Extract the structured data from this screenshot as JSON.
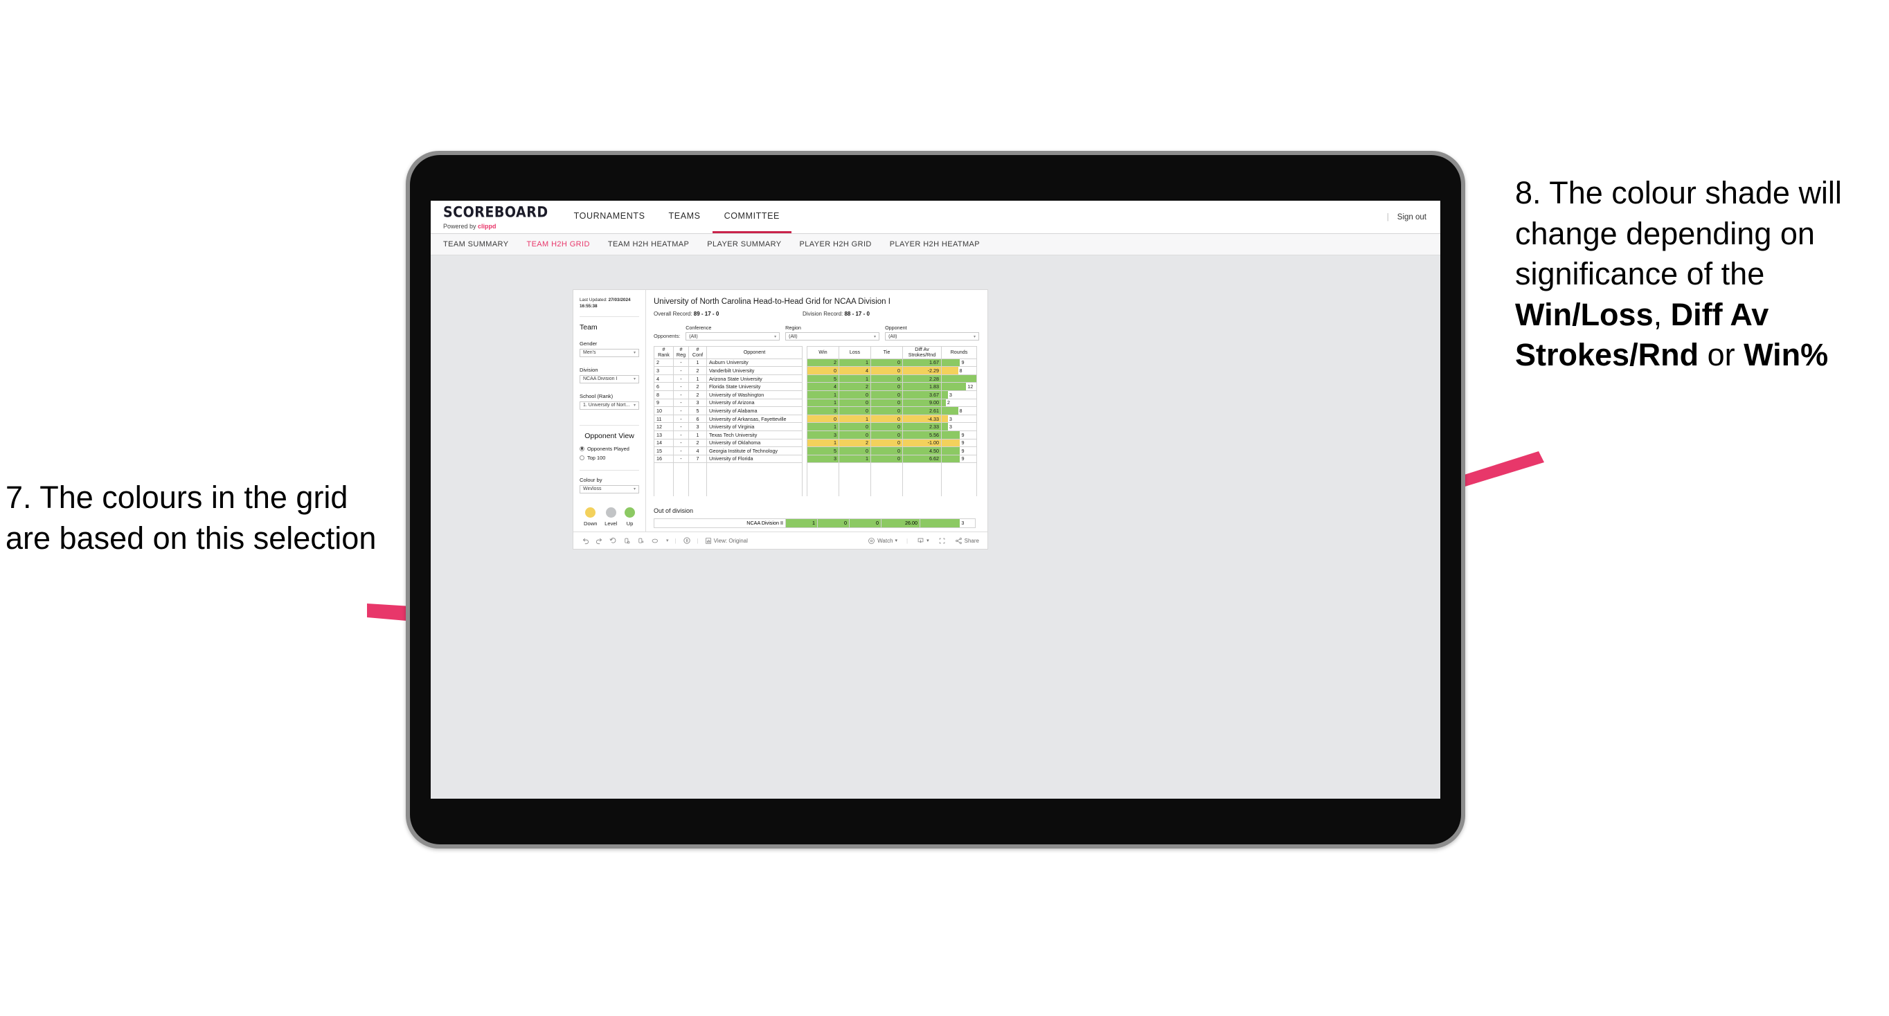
{
  "annotations": {
    "left": {
      "text": "7. The colours in the grid are based on this selection",
      "arrow_color": "#e8376a"
    },
    "right": {
      "line1": "8. The colour shade will change depending on significance of the ",
      "bold1": "Win/Loss",
      "mid1": ", ",
      "bold2": "Diff Av Strokes/Rnd",
      "mid2": " or ",
      "bold3": "Win%",
      "arrow_color": "#e8376a"
    }
  },
  "app": {
    "logo": {
      "word": "SCOREBOARD",
      "powered_prefix": "Powered by ",
      "brand": "clippd"
    },
    "topnav": [
      {
        "label": "TOURNAMENTS",
        "active": false
      },
      {
        "label": "TEAMS",
        "active": false
      },
      {
        "label": "COMMITTEE",
        "active": true
      }
    ],
    "signout": "Sign out",
    "divider": "|",
    "subnav": [
      {
        "label": "TEAM SUMMARY",
        "active": false
      },
      {
        "label": "TEAM H2H GRID",
        "active": true
      },
      {
        "label": "TEAM H2H HEATMAP",
        "active": false
      },
      {
        "label": "PLAYER SUMMARY",
        "active": false
      },
      {
        "label": "PLAYER H2H GRID",
        "active": false
      },
      {
        "label": "PLAYER H2H HEATMAP",
        "active": false
      }
    ]
  },
  "pane": {
    "last_updated_label": "Last Updated: ",
    "last_updated_value": "27/03/2024 16:55:38",
    "team_heading": "Team",
    "gender_label": "Gender",
    "gender_value": "Men's",
    "division_label": "Division",
    "division_value": "NCAA Division I",
    "school_label": "School (Rank)",
    "school_value": "1. University of Nort...",
    "opponent_view_heading": "Opponent View",
    "opponent_view_options": [
      {
        "label": "Opponents Played",
        "selected": true
      },
      {
        "label": "Top 100",
        "selected": false
      }
    ],
    "colour_by_label": "Colour by",
    "colour_by_value": "Win/loss",
    "legend": [
      {
        "caption": "Down",
        "color": "#f3d15c"
      },
      {
        "caption": "Level",
        "color": "#c2c4c6"
      },
      {
        "caption": "Up",
        "color": "#8cc963"
      }
    ]
  },
  "main": {
    "title": "University of North Carolina Head-to-Head Grid for NCAA Division I",
    "overall_record_label": "Overall Record: ",
    "overall_record_value": "89 - 17 - 0",
    "division_record_label": "Division Record: ",
    "division_record_value": "88 - 17 - 0",
    "opponents_label": "Opponents:",
    "filters": [
      {
        "label": "Conference",
        "value": "(All)"
      },
      {
        "label": "Region",
        "value": "(All)"
      },
      {
        "label": "Opponent",
        "value": "(All)"
      }
    ]
  },
  "chart_data": {
    "type": "table",
    "title": "University of North Carolina Head-to-Head Grid for NCAA Division I",
    "columns": [
      "# Rank",
      "# Reg",
      "# Conf",
      "Opponent",
      "Win",
      "Loss",
      "Tie",
      "Diff Av Strokes/Rnd",
      "Rounds"
    ],
    "column_headers_multiline": [
      [
        "#",
        "Rank"
      ],
      [
        "#",
        "Reg"
      ],
      [
        "#",
        "Conf"
      ],
      [
        "",
        "Opponent"
      ],
      [
        "",
        "Win"
      ],
      [
        "",
        "Loss"
      ],
      [
        "",
        "Tie"
      ],
      [
        "Diff Av",
        "Strokes/Rnd"
      ],
      [
        "",
        "Rounds"
      ]
    ],
    "rounds_max": 17,
    "colors": {
      "up": "#8cc963",
      "down": "#f3d15c",
      "level": "#c2c4c6"
    },
    "rows": [
      {
        "rank": "2",
        "reg": "-",
        "conf": "1",
        "opponent": "Auburn University",
        "win": 2,
        "loss": 1,
        "tie": 0,
        "diff": "1.67",
        "rounds": 9,
        "shade": "up"
      },
      {
        "rank": "3",
        "reg": "-",
        "conf": "2",
        "opponent": "Vanderbilt University",
        "win": 0,
        "loss": 4,
        "tie": 0,
        "diff": "-2.29",
        "rounds": 8,
        "shade": "down"
      },
      {
        "rank": "4",
        "reg": "-",
        "conf": "1",
        "opponent": "Arizona State University",
        "win": 5,
        "loss": 1,
        "tie": 0,
        "diff": "2.28",
        "rounds": 17,
        "shade": "up"
      },
      {
        "rank": "6",
        "reg": "-",
        "conf": "2",
        "opponent": "Florida State University",
        "win": 4,
        "loss": 2,
        "tie": 0,
        "diff": "1.83",
        "rounds": 12,
        "shade": "up"
      },
      {
        "rank": "8",
        "reg": "-",
        "conf": "2",
        "opponent": "University of Washington",
        "win": 1,
        "loss": 0,
        "tie": 0,
        "diff": "3.67",
        "rounds": 3,
        "shade": "up"
      },
      {
        "rank": "9",
        "reg": "-",
        "conf": "3",
        "opponent": "University of Arizona",
        "win": 1,
        "loss": 0,
        "tie": 0,
        "diff": "9.00",
        "rounds": 2,
        "shade": "up"
      },
      {
        "rank": "10",
        "reg": "-",
        "conf": "5",
        "opponent": "University of Alabama",
        "win": 3,
        "loss": 0,
        "tie": 0,
        "diff": "2.61",
        "rounds": 8,
        "shade": "up"
      },
      {
        "rank": "11",
        "reg": "-",
        "conf": "6",
        "opponent": "University of Arkansas, Fayetteville",
        "win": 0,
        "loss": 1,
        "tie": 0,
        "diff": "-4.33",
        "rounds": 3,
        "shade": "down"
      },
      {
        "rank": "12",
        "reg": "-",
        "conf": "3",
        "opponent": "University of Virginia",
        "win": 1,
        "loss": 0,
        "tie": 0,
        "diff": "2.33",
        "rounds": 3,
        "shade": "up"
      },
      {
        "rank": "13",
        "reg": "-",
        "conf": "1",
        "opponent": "Texas Tech University",
        "win": 3,
        "loss": 0,
        "tie": 0,
        "diff": "5.56",
        "rounds": 9,
        "shade": "up"
      },
      {
        "rank": "14",
        "reg": "-",
        "conf": "2",
        "opponent": "University of Oklahoma",
        "win": 1,
        "loss": 2,
        "tie": 0,
        "diff": "-1.00",
        "rounds": 9,
        "shade": "down"
      },
      {
        "rank": "15",
        "reg": "-",
        "conf": "4",
        "opponent": "Georgia Institute of Technology",
        "win": 5,
        "loss": 0,
        "tie": 0,
        "diff": "4.50",
        "rounds": 9,
        "shade": "up"
      },
      {
        "rank": "16",
        "reg": "-",
        "conf": "7",
        "opponent": "University of Florida",
        "win": 3,
        "loss": 1,
        "tie": 0,
        "diff": "6.62",
        "rounds": 9,
        "shade": "up"
      }
    ]
  },
  "out_of_division": {
    "title": "Out of division",
    "row": {
      "name": "NCAA Division II",
      "win": 1,
      "loss": 0,
      "tie": 0,
      "diff": "26.00",
      "rounds": 3,
      "shade": "up"
    }
  },
  "toolbar": {
    "undo": "undo-icon",
    "redo": "redo-icon",
    "revert": "revert-icon",
    "refresh": "refresh-data-icon",
    "pause": "pause-icon",
    "view_label": "View: Original",
    "watch_label": "Watch",
    "share_label": "Share"
  }
}
